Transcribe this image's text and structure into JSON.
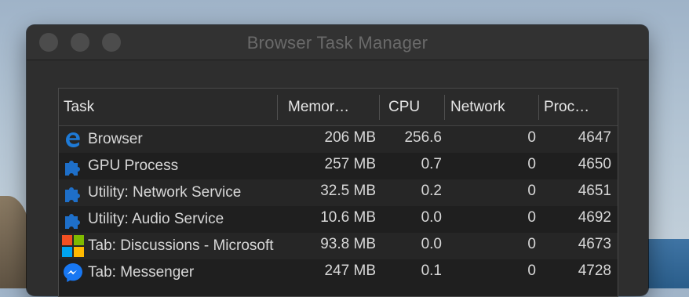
{
  "window": {
    "title": "Browser Task Manager"
  },
  "table": {
    "columns": [
      "Task",
      "Memor…",
      "CPU",
      "Network",
      "Proc…"
    ],
    "rows": [
      {
        "icon": "edge-browser-icon",
        "task": "Browser",
        "memory": "206 MB",
        "cpu": "256.6",
        "network": "0",
        "pid": "4647"
      },
      {
        "icon": "puzzle-extension-icon",
        "task": "GPU Process",
        "memory": "257 MB",
        "cpu": "0.7",
        "network": "0",
        "pid": "4650"
      },
      {
        "icon": "puzzle-extension-icon",
        "task": "Utility: Network Service",
        "memory": "32.5 MB",
        "cpu": "0.2",
        "network": "0",
        "pid": "4651"
      },
      {
        "icon": "puzzle-extension-icon",
        "task": "Utility: Audio Service",
        "memory": "10.6 MB",
        "cpu": "0.0",
        "network": "0",
        "pid": "4692"
      },
      {
        "icon": "microsoft-logo-icon",
        "task": "Tab: Discussions - Microsoft",
        "memory": "93.8 MB",
        "cpu": "0.0",
        "network": "0",
        "pid": "4673"
      },
      {
        "icon": "messenger-icon",
        "task": "Tab: Messenger",
        "memory": "247 MB",
        "cpu": "0.1",
        "network": "0",
        "pid": "4728"
      }
    ]
  },
  "colors": {
    "window_bg": "#2e2e2e",
    "panel_bg": "#1f1f1f",
    "text": "#d8d8d8",
    "icon_blue": "#1e6fc9"
  }
}
